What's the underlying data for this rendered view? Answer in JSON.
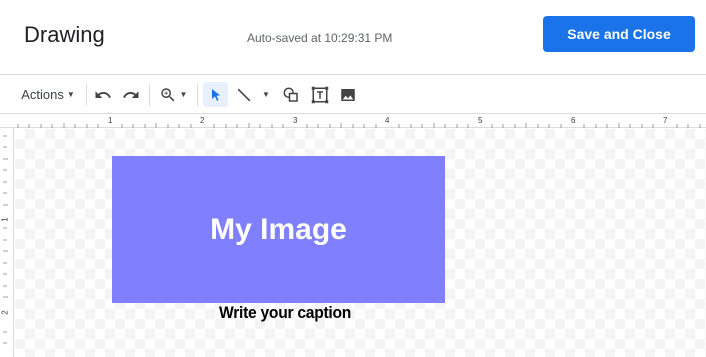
{
  "header": {
    "title": "Drawing",
    "autosave_text": "Auto-saved at 10:29:31 PM",
    "save_close_label": "Save and Close",
    "accent_color": "#1a73e8"
  },
  "toolbar": {
    "actions_label": "Actions",
    "icons": [
      "undo-icon",
      "redo-icon",
      "zoom-icon",
      "select-icon",
      "line-icon",
      "shape-icon",
      "text-box-icon",
      "image-icon"
    ],
    "active_tool": "select"
  },
  "ruler": {
    "top_numbers": [
      "1",
      "2",
      "3",
      "4",
      "5",
      "6",
      "7"
    ],
    "left_numbers": [
      "1",
      "2"
    ]
  },
  "canvas": {
    "image_label": "My Image",
    "image_color": "#8080ff",
    "caption": "Write your caption"
  }
}
